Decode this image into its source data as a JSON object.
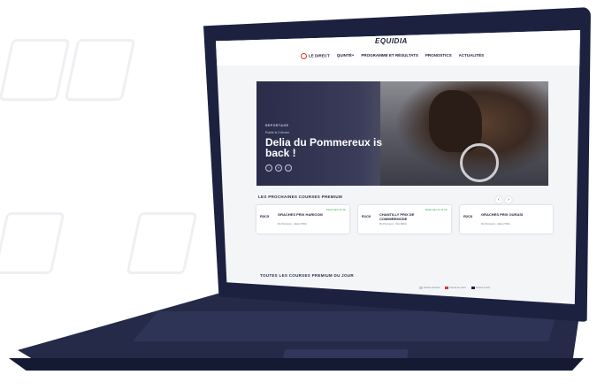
{
  "brand": {
    "logo": "EQUIDIA"
  },
  "nav": {
    "items": [
      {
        "label": "LE DIRECT",
        "icon": "live-icon"
      },
      {
        "label": "QUINTÉ+"
      },
      {
        "label": "PROGRAMME ET RÉSULTATS"
      },
      {
        "label": "PRONOSTICS"
      },
      {
        "label": "ACTUALITÉS"
      }
    ]
  },
  "hero": {
    "tag": "REPORTAGE",
    "subtitle": "Publié le 2 février",
    "title": "Delia du Pommereux is back !",
    "controls": [
      "‹",
      "⏸",
      "›"
    ]
  },
  "next_races": {
    "title": "LES PROCHAINES COURSES PREMIUM",
    "arrows": [
      "‹",
      "›"
    ],
    "cards": [
      {
        "code": "R3C5",
        "name": "GRACHES PRIX HARICOM",
        "meta": "Mo Pommercy · Attelé 2700m",
        "tag": "Départ dans 41 min"
      },
      {
        "code": "R1C6",
        "name": "CHANTILLY PRIX DE COMMIREMODE",
        "meta": "Mo Pommercy · Plat 1900m",
        "tag": "Départ dans 1h 15 min"
      },
      {
        "code": "R2C6",
        "name": "GRACHES PRIX OURASI",
        "meta": "Mo Pommercy · Attelé 2700m",
        "tag": ""
      }
    ]
  },
  "all_races": {
    "title": "TOUTES LES COURSES PREMIUM DU JOUR"
  },
  "legend": [
    {
      "label": "Course terminée",
      "color": "#c9cbd3"
    },
    {
      "label": "Course en cours",
      "color": "#e0332a"
    },
    {
      "label": "Course à venir",
      "color": "#1b1f3b"
    }
  ],
  "colors": {
    "accent": "#e0332a",
    "navy": "#1b1f3b"
  }
}
